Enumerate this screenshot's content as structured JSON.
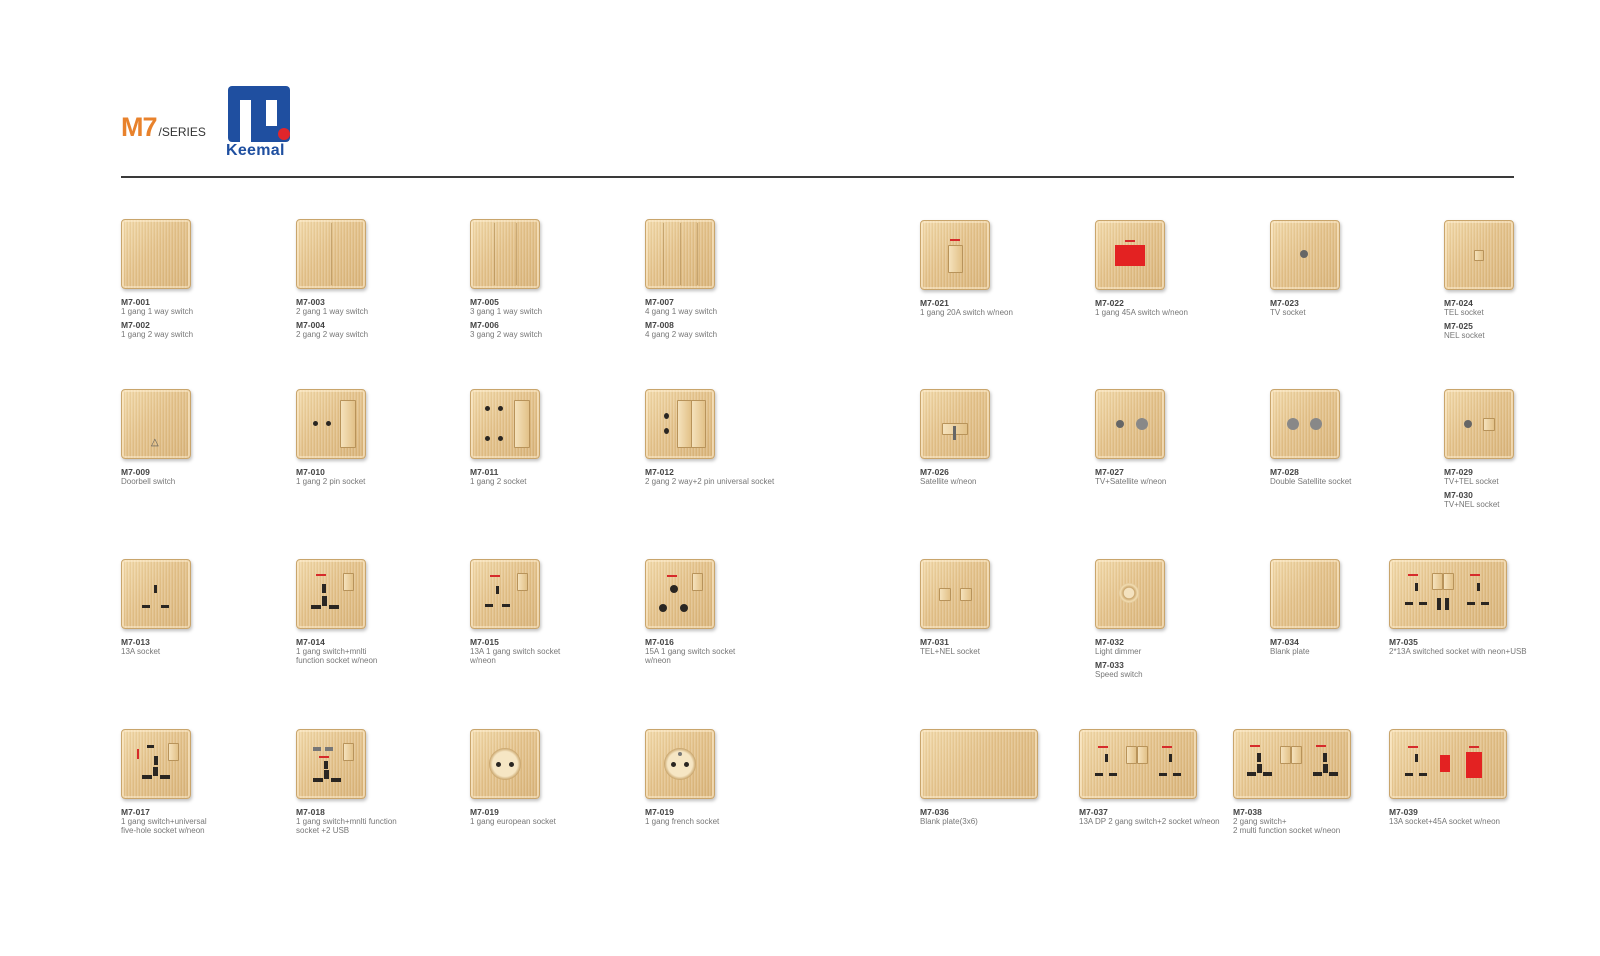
{
  "header": {
    "series": "M7",
    "series_label": "/SERIES",
    "brand": "Keemal"
  },
  "colors": {
    "accent": "#e8822c",
    "brand": "#1f4fa0",
    "logo_dot": "#e0262b",
    "plate": "#e4c28a",
    "neon": "#d62b2b"
  },
  "products": {
    "p001": {
      "code": "M7-001",
      "desc": "1 gang 1 way switch"
    },
    "p002": {
      "code": "M7-002",
      "desc": "1 gang 2 way switch"
    },
    "p003": {
      "code": "M7-003",
      "desc": "2 gang 1 way switch"
    },
    "p004": {
      "code": "M7-004",
      "desc": "2 gang 2 way switch"
    },
    "p005": {
      "code": "M7-005",
      "desc": "3 gang 1 way switch"
    },
    "p006": {
      "code": "M7-006",
      "desc": "3 gang 2 way switch"
    },
    "p007": {
      "code": "M7-007",
      "desc": "4 gang 1 way switch"
    },
    "p008": {
      "code": "M7-008",
      "desc": "4 gang 2 way switch"
    },
    "p021": {
      "code": "M7-021",
      "desc": "1 gang 20A switch w/neon"
    },
    "p022": {
      "code": "M7-022",
      "desc": "1 gang 45A switch w/neon"
    },
    "p023": {
      "code": "M7-023",
      "desc": "TV socket"
    },
    "p024": {
      "code": "M7-024",
      "desc": "TEL socket"
    },
    "p025": {
      "code": "M7-025",
      "desc": "NEL socket"
    },
    "p009": {
      "code": "M7-009",
      "desc": "Doorbell switch"
    },
    "p010": {
      "code": "M7-010",
      "desc": "1 gang 2 pin socket"
    },
    "p011": {
      "code": "M7-011",
      "desc": "1 gang 2 socket"
    },
    "p012": {
      "code": "M7-012",
      "desc": "2 gang 2 way+2 pin universal socket"
    },
    "p026": {
      "code": "M7-026",
      "desc": "Satellite w/neon"
    },
    "p027": {
      "code": "M7-027",
      "desc": "TV+Satellite w/neon"
    },
    "p028": {
      "code": "M7-028",
      "desc": "Double Satellite socket"
    },
    "p029": {
      "code": "M7-029",
      "desc": "TV+TEL socket"
    },
    "p030": {
      "code": "M7-030",
      "desc": "TV+NEL socket"
    },
    "p013": {
      "code": "M7-013",
      "desc": "13A socket"
    },
    "p014": {
      "code": "M7-014",
      "desc1": "1 gang switch+mnlti",
      "desc2": "function socket w/neon"
    },
    "p015": {
      "code": "M7-015",
      "desc1": "13A 1 gang switch socket",
      "desc2": "w/neon"
    },
    "p016": {
      "code": "M7-016",
      "desc1": "15A 1 gang switch socket",
      "desc2": "w/neon"
    },
    "p031": {
      "code": "M7-031",
      "desc": "TEL+NEL socket"
    },
    "p032": {
      "code": "M7-032",
      "desc": "Light dimmer"
    },
    "p033": {
      "code": "M7-033",
      "desc": "Speed switch"
    },
    "p034": {
      "code": "M7-034",
      "desc": "Blank plate"
    },
    "p035": {
      "code": "M7-035",
      "desc": "2*13A switched socket with neon+USB"
    },
    "p017": {
      "code": "M7-017",
      "desc1": "1 gang switch+universal",
      "desc2": "five-hole socket w/neon"
    },
    "p018": {
      "code": "M7-018",
      "desc1": "1 gang switch+mnlti function",
      "desc2": "socket +2 USB"
    },
    "p019a": {
      "code": "M7-019",
      "desc": "1 gang european socket"
    },
    "p019b": {
      "code": "M7-019",
      "desc": "1 gang french socket"
    },
    "p036": {
      "code": "M7-036",
      "desc": "Blank plate(3x6)"
    },
    "p037": {
      "code": "M7-037",
      "desc": "13A DP 2 gang switch+2 socket w/neon"
    },
    "p038": {
      "code": "M7-038",
      "desc1": "2 gang switch+",
      "desc2": "2 multi function socket w/neon"
    },
    "p039": {
      "code": "M7-039",
      "desc": "13A socket+45A socket w/neon"
    }
  }
}
